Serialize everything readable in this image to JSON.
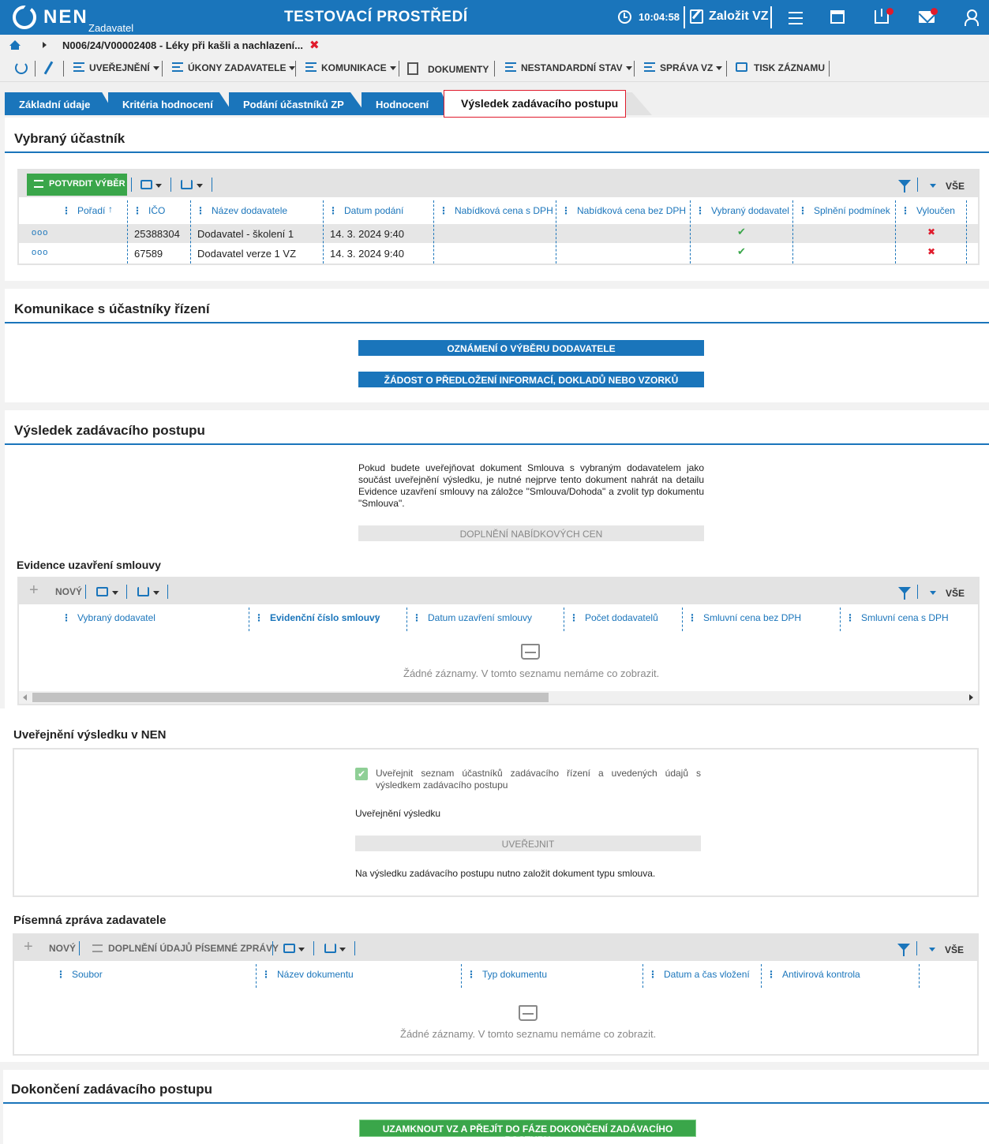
{
  "header": {
    "logo": "NEN",
    "logo_sub": "Zadavatel",
    "env_title": "TESTOVACÍ PROSTŘEDÍ",
    "clock": "10:04:58",
    "create_label": "Založit VZ"
  },
  "breadcrumb": {
    "label": "N006/24/V00002408 - Léky při kašli a nachlazení...",
    "close": "✖"
  },
  "toolbar": {
    "items": [
      {
        "label": "UVEŘEJNĚNÍ"
      },
      {
        "label": "ÚKONY ZADAVATELE"
      },
      {
        "label": "KOMUNIKACE"
      },
      {
        "label": "DOKUMENTY"
      },
      {
        "label": "NESTANDARDNÍ STAV"
      },
      {
        "label": "SPRÁVA VZ"
      },
      {
        "label": "TISK ZÁZNAMU"
      }
    ]
  },
  "tabs": [
    {
      "label": "Základní údaje"
    },
    {
      "label": "Kritéria hodnocení"
    },
    {
      "label": "Podání účastníků ZP"
    },
    {
      "label": "Hodnocení"
    },
    {
      "label": "Výsledek zadávacího postupu"
    }
  ],
  "selected": {
    "title": "Vybraný účastník",
    "confirm_button": "POTVRDIT VÝBĚR",
    "vse": "VŠE",
    "columns": [
      "Pořadí",
      "IČO",
      "Název dodavatele",
      "Datum podání",
      "Nabídková cena s DPH",
      "Nabídková cena bez DPH",
      "Vybraný dodavatel",
      "Splnění podmínek",
      "Vyloučen"
    ],
    "rows": [
      {
        "menu": "ooo",
        "ico": "25388304",
        "name": "Dodavatel - školení 1",
        "date": "14. 3. 2024 9:40",
        "selected": "✔",
        "excluded": "✖"
      },
      {
        "menu": "ooo",
        "ico": "67589",
        "name": "Dodavatel verze 1 VZ",
        "date": "14. 3. 2024 9:40",
        "selected": "✔",
        "excluded": "✖"
      }
    ]
  },
  "communication": {
    "title": "Komunikace s účastníky řízení",
    "btn1": "OZNÁMENÍ O VÝBĚRU DODAVATELE",
    "btn2": "ŽÁDOST O PŘEDLOŽENÍ INFORMACÍ, DOKLADŮ NEBO VZORKŮ"
  },
  "result": {
    "title": "Výsledek zadávacího postupu",
    "info": "Pokud budete uveřejňovat dokument Smlouva s vybraným dodavatelem jako součást uveřejnění výsledku, je nutné nejprve tento dokument nahrát na detailu Evidence uzavření smlouvy na záložce \"Smlouva/Dohoda\" a zvolit typ dokumentu \"Smlouva\".",
    "price_button": "DOPLNĚNÍ NABÍDKOVÝCH CEN"
  },
  "contracts": {
    "title": "Evidence uzavření smlouvy",
    "new_label": "NOVÝ",
    "vse": "VŠE",
    "columns": [
      "Vybraný dodavatel",
      "Evidenční číslo smlouvy",
      "Datum uzavření smlouvy",
      "Počet dodavatelů",
      "Smluvní cena bez DPH",
      "Smluvní cena s DPH"
    ],
    "empty": "Žádné záznamy. V tomto seznamu nemáme co zobrazit."
  },
  "publication": {
    "title": "Uveřejnění výsledku v NEN",
    "checkbox_label": "Uveřejnit seznam účastníků zadávacího řízení a uvedených údajů s výsledkem zadávacího postupu",
    "subtitle": "Uveřejnění výsledku",
    "publish_button": "UVEŘEJNIT",
    "note": "Na výsledku zadávacího postupu nutno založit dokument typu smlouva."
  },
  "report": {
    "title": "Písemná zpráva zadavatele",
    "new_label": "NOVÝ",
    "fill_label": "DOPLNĚNÍ ÚDAJŮ PÍSEMNÉ ZPRÁVY",
    "vse": "VŠE",
    "columns": [
      "Soubor",
      "Název dokumentu",
      "Typ dokumentu",
      "Datum a čas vložení",
      "Antivirová kontrola"
    ],
    "empty": "Žádné záznamy. V tomto seznamu nemáme co zobrazit."
  },
  "completion": {
    "title": "Dokončení zadávacího postupu",
    "lock_button": "UZAMKNOUT VZ A PŘEJÍT DO FÁZE DOKONČENÍ ZADÁVACÍHO POSTUPU"
  },
  "colors": {
    "brand": "#1a75bb",
    "green": "#3aa64a",
    "red": "#e01b2c"
  }
}
